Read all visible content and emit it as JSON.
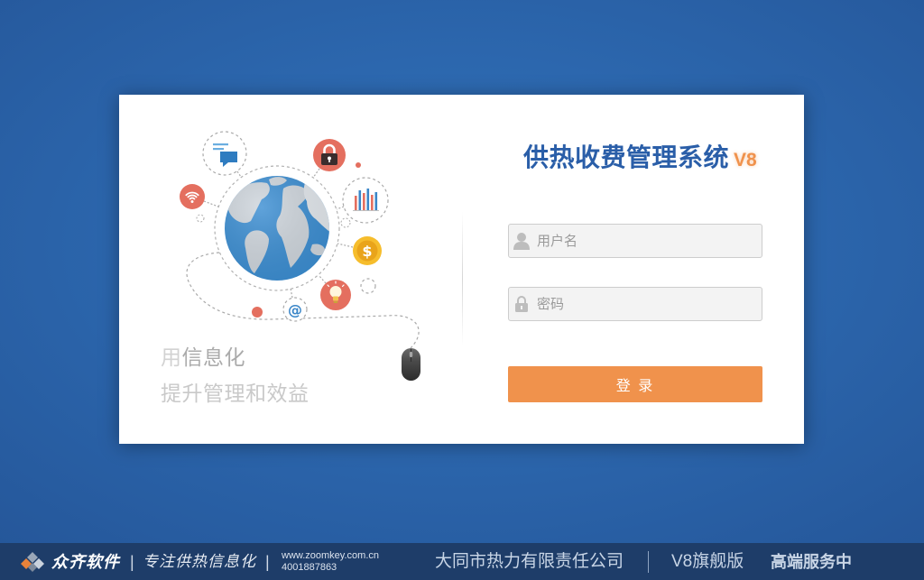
{
  "app": {
    "title": "供热收费管理系统",
    "version": "V8"
  },
  "slogan": {
    "line1_prefix": "用",
    "line1_rest": "信息化",
    "line2": "提升管理和效益"
  },
  "login": {
    "username": {
      "placeholder": "用户名",
      "value": "",
      "icon": "user-icon"
    },
    "password": {
      "placeholder": "密码",
      "value": "",
      "icon": "lock-icon"
    },
    "submit_label": "登 录"
  },
  "illustration": {
    "icons": [
      "globe-icon",
      "chat-icon",
      "lock-icon",
      "wifi-icon",
      "bar-chart-icon",
      "dollar-icon",
      "lightbulb-icon",
      "at-icon",
      "mouse-icon"
    ],
    "dollar_symbol": "$",
    "at_symbol": "@"
  },
  "footer": {
    "logo_icon": "zoomkey-logo-icon",
    "brand": "众齐软件",
    "separator": "|",
    "tagline": "专注供热信息化",
    "website": "www.zoomkey.com.cn",
    "phone": "4001887863",
    "company": "大同市热力有限责任公司",
    "edition": "V8旗舰版",
    "service": "高端服务中"
  },
  "colors": {
    "accent": "#f0924c",
    "title_blue": "#2a5ea8",
    "page_background": "#2c67ae",
    "footer_background": "#1e3d69",
    "icon_red": "#e46f5f",
    "icon_blue": "#3a86c8",
    "coin_gold": "#f6bd2c"
  }
}
